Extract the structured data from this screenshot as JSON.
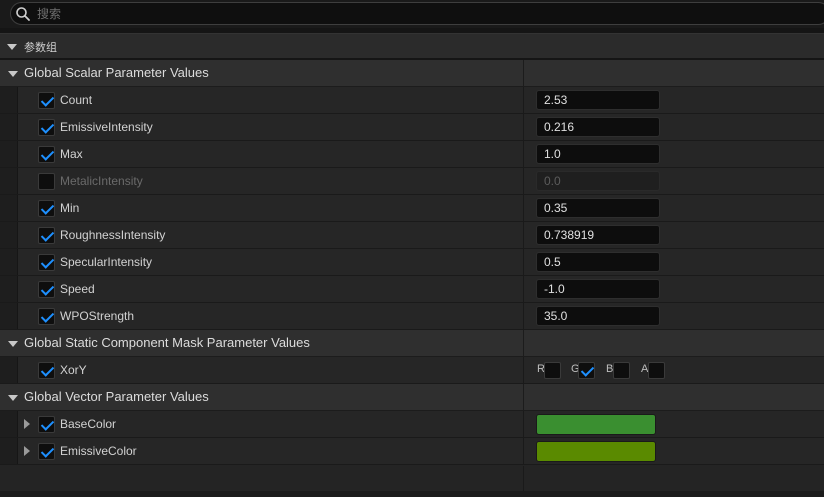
{
  "search": {
    "placeholder": "搜索",
    "value": ""
  },
  "group": {
    "title": "参数组"
  },
  "sections": {
    "scalar": {
      "title": "Global Scalar Parameter Values"
    },
    "mask": {
      "title": "Global Static Component Mask Parameter Values"
    },
    "vector": {
      "title": "Global Vector Parameter Values"
    }
  },
  "scalar_params": [
    {
      "label": "Count",
      "value": "2.53",
      "checked": true
    },
    {
      "label": "EmissiveIntensity",
      "value": "0.216",
      "checked": true
    },
    {
      "label": "Max",
      "value": "1.0",
      "checked": true
    },
    {
      "label": "MetalicIntensity",
      "value": "0.0",
      "checked": false
    },
    {
      "label": "Min",
      "value": "0.35",
      "checked": true
    },
    {
      "label": "RoughnessIntensity",
      "value": "0.738919",
      "checked": true
    },
    {
      "label": "SpecularIntensity",
      "value": "0.5",
      "checked": true
    },
    {
      "label": "Speed",
      "value": "-1.0",
      "checked": true
    },
    {
      "label": "WPOStrength",
      "value": "35.0",
      "checked": true
    }
  ],
  "mask_param": {
    "label": "XorY",
    "checked": true,
    "channels": [
      {
        "label": "R",
        "checked": false
      },
      {
        "label": "G",
        "checked": true
      },
      {
        "label": "B",
        "checked": false
      },
      {
        "label": "A",
        "checked": false
      }
    ]
  },
  "vector_params": [
    {
      "label": "BaseColor",
      "checked": true,
      "color": "#3a8f30"
    },
    {
      "label": "EmissiveColor",
      "checked": true,
      "color": "#5a8a00"
    }
  ],
  "colors": {
    "accent": "#1e90ff"
  }
}
